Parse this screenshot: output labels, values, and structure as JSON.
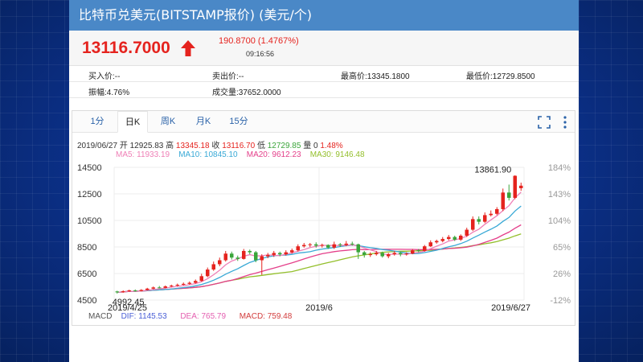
{
  "title": "比特币兑美元(BITSTAMP报价) (美元/个)",
  "quote": {
    "price": "13116.7000",
    "change": "190.8700 (1.4767%)",
    "time": "09:16:56"
  },
  "stats": {
    "bid_label": "买入价:",
    "bid_value": "--",
    "ask_label": "卖出价:",
    "ask_value": "--",
    "high_label": "最高价:",
    "high_value": "13345.1800",
    "low_label": "最低价:",
    "low_value": "12729.8500",
    "amp_label": "振幅:",
    "amp_value": "4.76%",
    "vol_label": "成交量:",
    "vol_value": "37652.0000"
  },
  "tabs": [
    "1分",
    "日K",
    "周K",
    "月K",
    "15分"
  ],
  "active_tab": 1,
  "info": {
    "date": "2019/06/27",
    "open_label": "开",
    "open": "12925.83",
    "high_label": "高",
    "high": "13345.18",
    "close_label": "收",
    "close": "13116.70",
    "low_label": "低",
    "low": "12729.85",
    "vol_label": "量",
    "vol": "0",
    "pct": "1.48%"
  },
  "ma": {
    "ma5": "MA5: 11933.19",
    "ma10": "MA10: 10845.10",
    "ma20": "MA20: 9612.23",
    "ma30": "MA30: 9146.48"
  },
  "macd": {
    "label": "MACD",
    "dif": "DIF: 1145.53",
    "dea": "DEA: 765.79",
    "macd": "MACD: 759.48"
  },
  "colors": {
    "up": "#e5231e",
    "down": "#3aa53a",
    "ma5": "#ef7fb6",
    "ma10": "#39a9d6",
    "ma20": "#e43f8a",
    "ma30": "#93bf2b"
  },
  "chart_data": {
    "type": "candlestick",
    "y_ticks": [
      14500,
      12500,
      10500,
      8500,
      6500,
      4500
    ],
    "right_ticks": [
      "184%",
      "143%",
      "104%",
      "65%",
      "26%",
      "-12%"
    ],
    "ylim": [
      4500,
      14500
    ],
    "x_labels": [
      "2019/4/25",
      "2019/6",
      "2019/6/27"
    ],
    "max_label": "13861.90",
    "min_label": "4992.45",
    "candles": [
      [
        5150,
        5080,
        5200,
        4992
      ],
      [
        5090,
        5160,
        5230,
        5050
      ],
      [
        5160,
        5230,
        5280,
        5120
      ],
      [
        5230,
        5180,
        5300,
        5140
      ],
      [
        5180,
        5260,
        5320,
        5150
      ],
      [
        5260,
        5360,
        5420,
        5220
      ],
      [
        5360,
        5450,
        5520,
        5310
      ],
      [
        5450,
        5420,
        5560,
        5380
      ],
      [
        5420,
        5530,
        5600,
        5380
      ],
      [
        5530,
        5590,
        5660,
        5480
      ],
      [
        5590,
        5650,
        5740,
        5530
      ],
      [
        5650,
        5720,
        5820,
        5610
      ],
      [
        5720,
        5800,
        5900,
        5660
      ],
      [
        5800,
        5940,
        6050,
        5740
      ],
      [
        5940,
        6300,
        6480,
        5880
      ],
      [
        6300,
        6800,
        6950,
        6220
      ],
      [
        6800,
        7200,
        7400,
        6700
      ],
      [
        7200,
        7500,
        7700,
        7050
      ],
      [
        7500,
        8000,
        8200,
        7400
      ],
      [
        8000,
        7700,
        8150,
        7550
      ],
      [
        7700,
        7600,
        7850,
        7450
      ],
      [
        7600,
        8200,
        8350,
        7550
      ],
      [
        8200,
        8100,
        8300,
        7950
      ],
      [
        8100,
        7500,
        8200,
        7350
      ],
      [
        7500,
        7800,
        7950,
        6400
      ],
      [
        7800,
        7900,
        8050,
        7650
      ],
      [
        7900,
        8050,
        8200,
        7750
      ],
      [
        8050,
        7950,
        8150,
        7800
      ],
      [
        7950,
        8100,
        8250,
        7850
      ],
      [
        8100,
        8250,
        8380,
        8000
      ],
      [
        8250,
        8550,
        8700,
        8150
      ],
      [
        8550,
        8650,
        8800,
        8450
      ],
      [
        8650,
        8700,
        8800,
        8500
      ],
      [
        8700,
        8600,
        8850,
        8450
      ],
      [
        8600,
        8650,
        8750,
        8450
      ],
      [
        8650,
        8450,
        8700,
        8350
      ],
      [
        8450,
        8700,
        8900,
        8350
      ],
      [
        8700,
        8650,
        8800,
        8500
      ],
      [
        8650,
        8750,
        8950,
        8550
      ],
      [
        8750,
        8700,
        8900,
        8600
      ],
      [
        8700,
        8100,
        8750,
        7600
      ],
      [
        8100,
        7900,
        8200,
        7700
      ],
      [
        7900,
        7950,
        8100,
        7750
      ],
      [
        7950,
        8050,
        8200,
        7850
      ],
      [
        8050,
        7800,
        8150,
        7700
      ],
      [
        7800,
        7950,
        8050,
        7650
      ],
      [
        7950,
        8050,
        8200,
        7850
      ],
      [
        8050,
        7950,
        8150,
        7800
      ],
      [
        7950,
        8000,
        8100,
        7850
      ],
      [
        8000,
        8250,
        8350,
        7950
      ],
      [
        8250,
        8200,
        8350,
        8100
      ],
      [
        8200,
        8550,
        8650,
        8150
      ],
      [
        8550,
        8850,
        9000,
        8500
      ],
      [
        8850,
        8950,
        9050,
        8750
      ],
      [
        8950,
        9100,
        9250,
        8850
      ],
      [
        9100,
        9250,
        9400,
        9000
      ],
      [
        9250,
        9050,
        9350,
        8950
      ],
      [
        9050,
        9350,
        9450,
        8950
      ],
      [
        9350,
        9800,
        9950,
        9250
      ],
      [
        9800,
        10600,
        10800,
        9700
      ],
      [
        10600,
        10400,
        10800,
        10200
      ],
      [
        10400,
        10900,
        11100,
        10300
      ],
      [
        10900,
        11000,
        11250,
        10800
      ],
      [
        11000,
        11350,
        11500,
        10900
      ],
      [
        11350,
        12600,
        12900,
        11200
      ],
      [
        12600,
        12200,
        13200,
        12000
      ],
      [
        12200,
        13861,
        13900,
        12100
      ],
      [
        12926,
        13117,
        13345,
        12730
      ]
    ]
  }
}
